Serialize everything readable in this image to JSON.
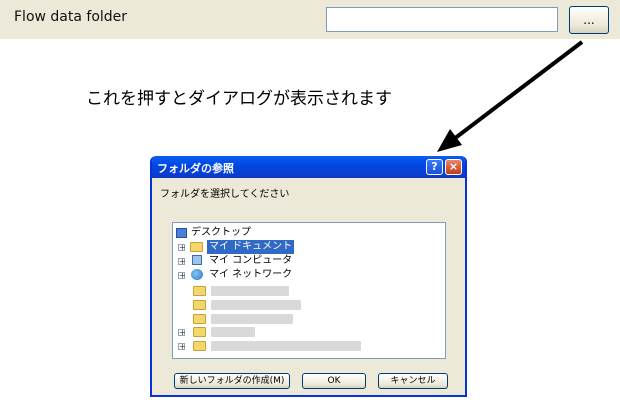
{
  "settings_row": {
    "label": "Flow data folder",
    "path_value": "",
    "browse_label": "..."
  },
  "caption": "これを押すとダイアログが表示されます",
  "dialog": {
    "title": "フォルダの参照",
    "help_label": "?",
    "close_label": "×",
    "instruction": "フォルダを選択してください",
    "tree": {
      "root": "デスクトップ",
      "items": [
        "マイ ドキュメント",
        "マイ コンピュータ",
        "マイ ネットワーク"
      ],
      "selected": "マイ ドキュメント"
    },
    "buttons": {
      "new_folder": "新しいフォルダの作成(M)",
      "ok": "OK",
      "cancel": "キャンセル"
    }
  },
  "colors": {
    "titlebar": "#0a5ef5",
    "selection": "#316ac5",
    "window_bg": "#ece9d8"
  }
}
